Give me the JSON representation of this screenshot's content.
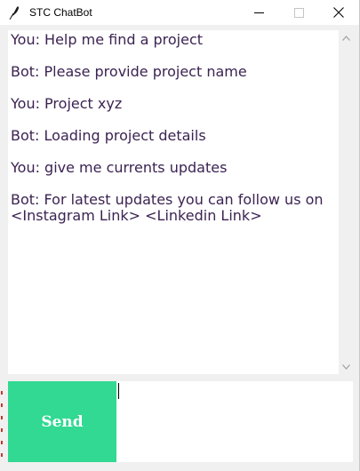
{
  "window": {
    "title": "STC ChatBot",
    "icon": "feather-icon",
    "controls": [
      "minimize-icon",
      "maximize-icon",
      "close-icon"
    ]
  },
  "chat": {
    "messages": [
      "You: Help me find a project",
      "Bot: Please provide project name",
      "You: Project xyz",
      "Bot: Loading project details",
      "You: give me currents updates",
      "Bot: For latest updates you can follow us on\n<Instagram Link> <Linkedin Link>"
    ],
    "text_color": "#3b2352"
  },
  "input": {
    "value": ""
  },
  "send": {
    "label": "Send",
    "color": "#32d993"
  }
}
